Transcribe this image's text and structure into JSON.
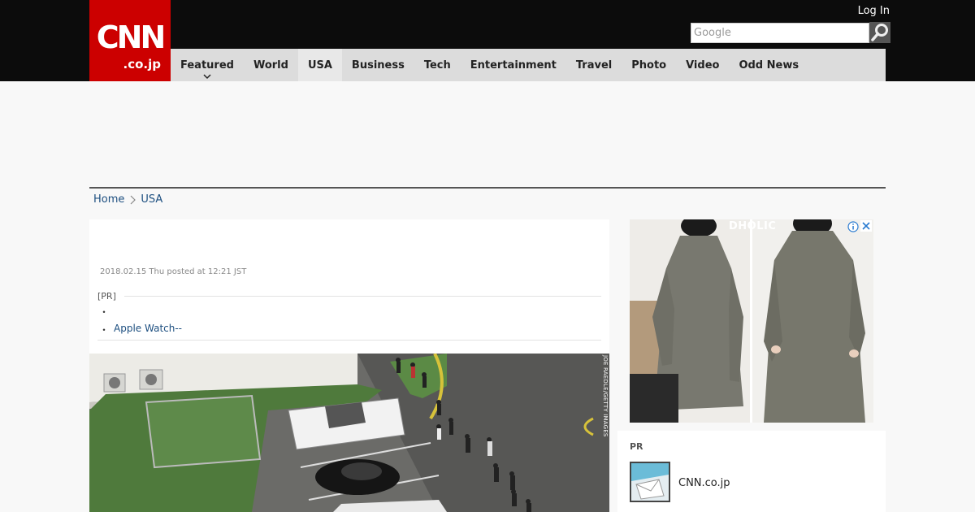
{
  "header": {
    "logo_main": "CNN",
    "logo_sub": ".co.jp",
    "login_label": "Log In",
    "search_placeholder": "Google"
  },
  "nav": {
    "items": [
      {
        "label": "Featured",
        "has_dropdown": true
      },
      {
        "label": "World"
      },
      {
        "label": "USA",
        "active": true
      },
      {
        "label": "Business"
      },
      {
        "label": "Tech"
      },
      {
        "label": "Entertainment"
      },
      {
        "label": "Travel"
      },
      {
        "label": "Photo"
      },
      {
        "label": "Video"
      },
      {
        "label": "Odd News"
      }
    ]
  },
  "breadcrumb": {
    "home": "Home",
    "section": "USA"
  },
  "article": {
    "date": "2018.02.15 Thu posted at 12:21 JST",
    "pr_label": "[PR]",
    "bullet1": "・",
    "bullet2_marker": "・",
    "bullet2_link": "Apple Watch--",
    "photo_credit": "JOE RAEDLE/GETTY IMAGES"
  },
  "ad": {
    "brand": "DHOLIC"
  },
  "pr_box": {
    "title": "PR",
    "link_label": "CNN.co.jp"
  },
  "colors": {
    "header_bg": "#0c0c0c",
    "logo_red": "#cc0000",
    "nav_bg": "#dcdcdc",
    "link_blue": "#1d4f80"
  }
}
